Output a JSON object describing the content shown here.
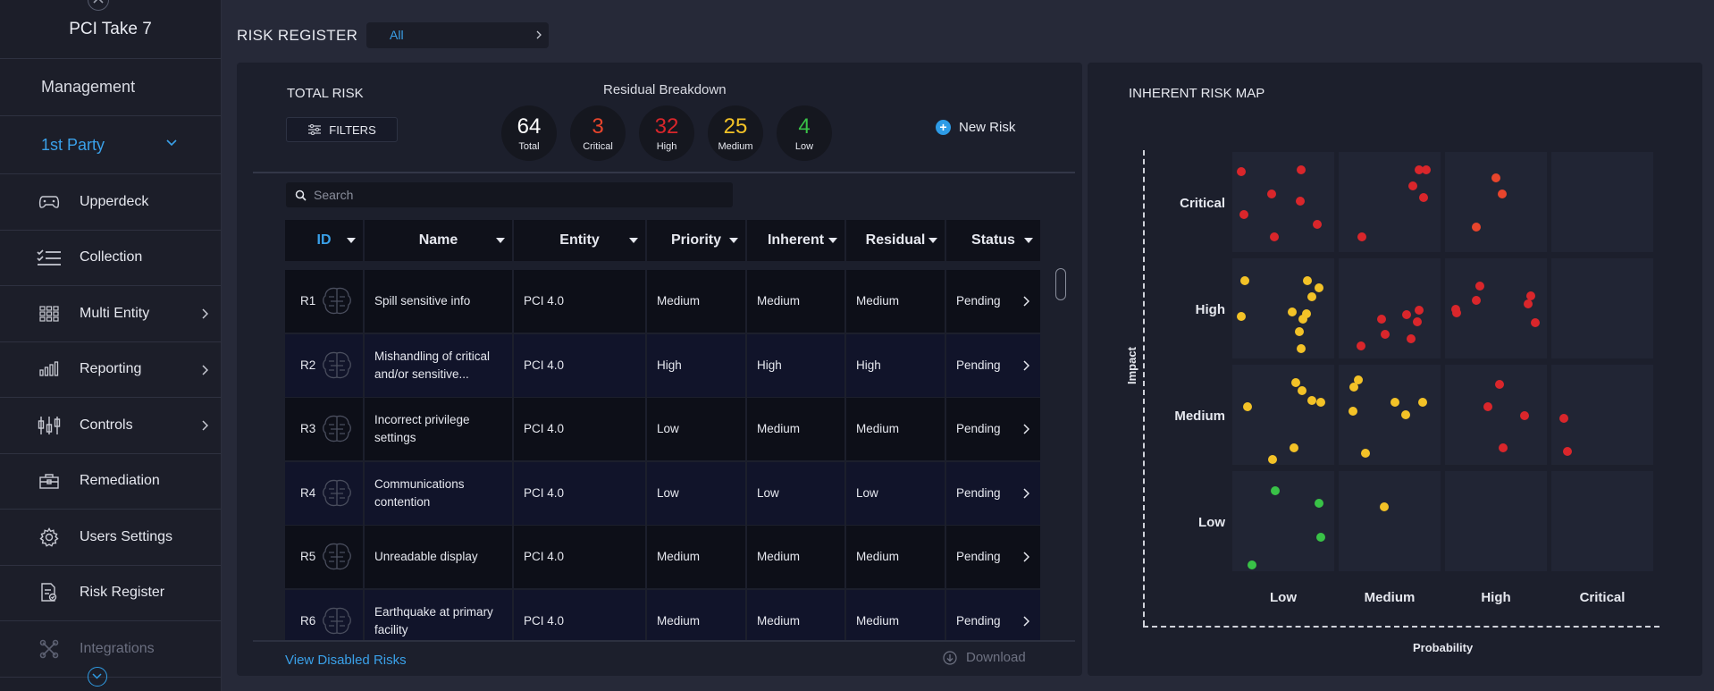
{
  "sidebar": {
    "brand": "PCI Take 7",
    "management": "Management",
    "party": "1st Party",
    "items": [
      {
        "label": "Upperdeck",
        "icon": "gamepad-icon",
        "arrow": false
      },
      {
        "label": "Collection",
        "icon": "checklist-icon",
        "arrow": false
      },
      {
        "label": "Multi Entity",
        "icon": "grid-icon",
        "arrow": true
      },
      {
        "label": "Reporting",
        "icon": "bar-chart-icon",
        "arrow": true
      },
      {
        "label": "Controls",
        "icon": "sliders-icon",
        "arrow": true
      },
      {
        "label": "Remediation",
        "icon": "toolbox-icon",
        "arrow": false
      },
      {
        "label": "Users Settings",
        "icon": "gear-icon",
        "arrow": false
      },
      {
        "label": "Risk Register",
        "icon": "document-icon",
        "arrow": false
      },
      {
        "label": "Integrations",
        "icon": "integrations-icon",
        "arrow": false
      }
    ]
  },
  "header": {
    "title": "RISK REGISTER",
    "filter_value": "All"
  },
  "summary": {
    "total_label": "TOTAL RISK",
    "filters_label": "FILTERS",
    "breakdown_title": "Residual Breakdown",
    "counts": [
      {
        "value": "64",
        "label": "Total",
        "color": "#ffffff"
      },
      {
        "value": "3",
        "label": "Critical",
        "color": "#e8452c"
      },
      {
        "value": "32",
        "label": "High",
        "color": "#d9262b"
      },
      {
        "value": "25",
        "label": "Medium",
        "color": "#f3c227"
      },
      {
        "value": "4",
        "label": "Low",
        "color": "#39c247"
      }
    ],
    "new_risk_label": "New Risk"
  },
  "search": {
    "placeholder": "Search"
  },
  "table": {
    "columns": [
      "ID",
      "Name",
      "Entity",
      "Priority",
      "Inherent",
      "Residual",
      "Status"
    ],
    "rows": [
      {
        "id": "R1",
        "name": "Spill sensitive info",
        "entity": "PCI 4.0",
        "priority": "Medium",
        "inherent": "Medium",
        "residual": "Medium",
        "status": "Pending"
      },
      {
        "id": "R2",
        "name": "Mishandling of critical and/or sensitive...",
        "entity": "PCI 4.0",
        "priority": "High",
        "inherent": "High",
        "residual": "High",
        "status": "Pending"
      },
      {
        "id": "R3",
        "name": "Incorrect privilege settings",
        "entity": "PCI 4.0",
        "priority": "Low",
        "inherent": "Medium",
        "residual": "Medium",
        "status": "Pending"
      },
      {
        "id": "R4",
        "name": "Communications contention",
        "entity": "PCI 4.0",
        "priority": "Low",
        "inherent": "Low",
        "residual": "Low",
        "status": "Pending"
      },
      {
        "id": "R5",
        "name": "Unreadable display",
        "entity": "PCI 4.0",
        "priority": "Medium",
        "inherent": "Medium",
        "residual": "Medium",
        "status": "Pending"
      },
      {
        "id": "R6",
        "name": "Earthquake at primary facility",
        "entity": "PCI 4.0",
        "priority": "Medium",
        "inherent": "Medium",
        "residual": "Medium",
        "status": "Pending"
      }
    ]
  },
  "footer": {
    "view_disabled": "View Disabled Risks",
    "download": "Download"
  },
  "risk_map": {
    "title": "INHERENT RISK MAP",
    "y_axis": "Impact",
    "x_axis": "Probability",
    "impact_levels": [
      "Critical",
      "High",
      "Medium",
      "Low"
    ],
    "probability_levels": [
      "Low",
      "Medium",
      "High",
      "Critical"
    ],
    "colors": {
      "critical": "#e8452c",
      "high": "#d9262b",
      "medium": "#f3c227",
      "low": "#39c247"
    }
  }
}
